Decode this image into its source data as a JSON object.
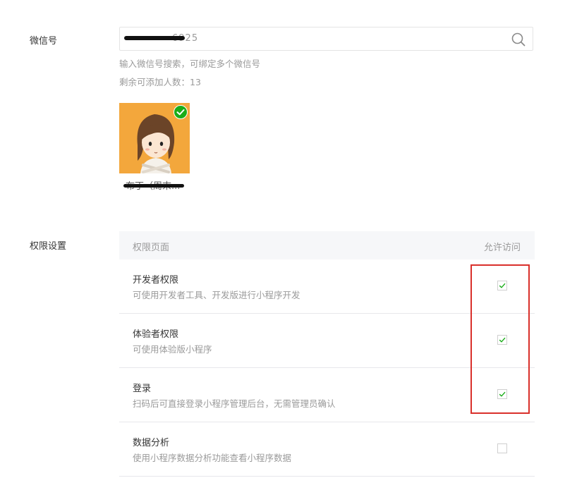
{
  "form": {
    "wechat_label": "微信号",
    "search_value": "6925",
    "hint": "输入微信号搜索，可绑定多个微信号",
    "remaining": "剩余可添加人数：13"
  },
  "member": {
    "nickname": "布丁（周末..."
  },
  "permissions": {
    "section_label": "权限设置",
    "col_page": "权限页面",
    "col_allow": "允许访问",
    "rows": [
      {
        "title": "开发者权限",
        "desc": "可使用开发者工具、开发版进行小程序开发",
        "checked": true
      },
      {
        "title": "体验者权限",
        "desc": "可使用体验版小程序",
        "checked": true
      },
      {
        "title": "登录",
        "desc": "扫码后可直接登录小程序管理后台，无需管理员确认",
        "checked": true
      },
      {
        "title": "数据分析",
        "desc": "使用小程序数据分析功能查看小程序数据",
        "checked": false
      }
    ]
  },
  "colors": {
    "check_green": "#1aad19",
    "highlight_red": "#d9302b",
    "avatar_bg": "#f3a73c"
  }
}
